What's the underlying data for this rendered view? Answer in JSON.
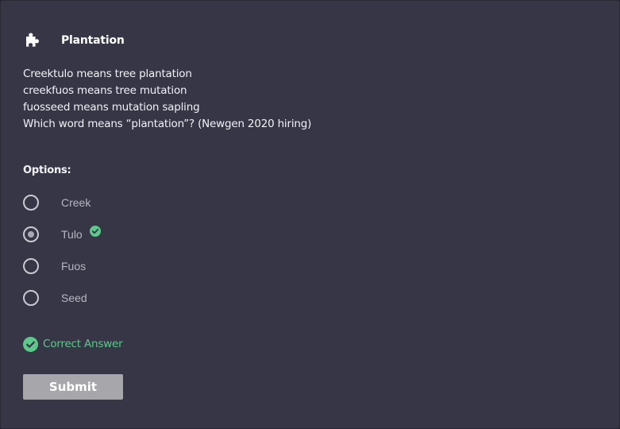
{
  "header": {
    "icon": "puzzle-piece-icon",
    "title": "Plantation"
  },
  "question": {
    "lines": [
      "Creektulo means tree plantation",
      "creekfuos means tree mutation",
      "fuosseed means mutation sapling",
      "Which word means “plantation”? (Newgen 2020 hiring)"
    ]
  },
  "options": {
    "label": "Options:",
    "items": [
      {
        "label": "Creek",
        "selected": false,
        "correct": false
      },
      {
        "label": "Tulo",
        "selected": true,
        "correct": true
      },
      {
        "label": "Fuos",
        "selected": false,
        "correct": false
      },
      {
        "label": "Seed",
        "selected": false,
        "correct": false
      }
    ]
  },
  "feedback": {
    "icon": "check-circle-icon",
    "text": "Correct Answer"
  },
  "submit": {
    "label": "Submit"
  },
  "colors": {
    "background": "#363647",
    "success": "#5cc98a",
    "button": "#a6a6ab"
  }
}
